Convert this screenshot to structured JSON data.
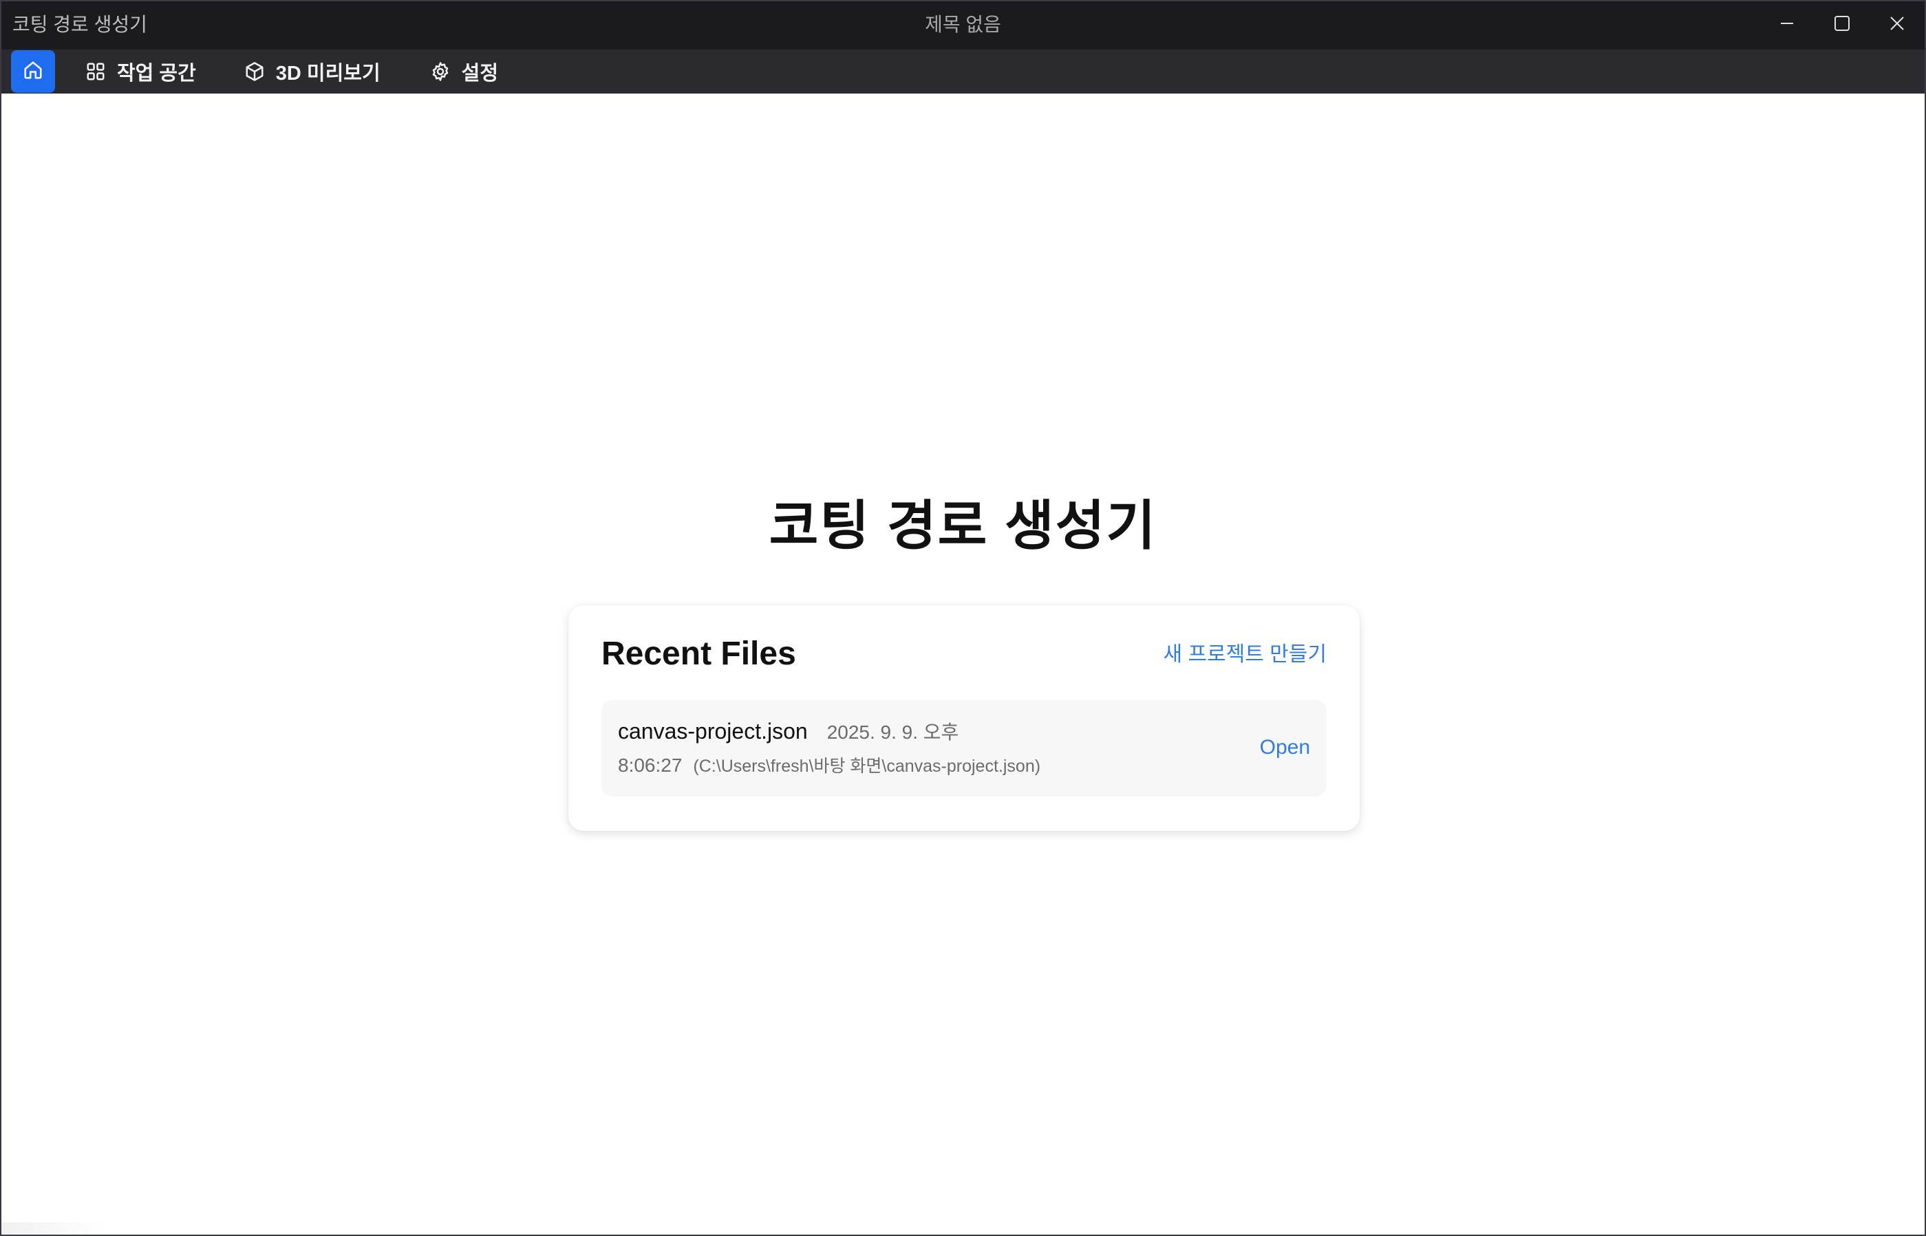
{
  "window": {
    "app_title": "코팅 경로 생성기",
    "document_title": "제목 없음",
    "controls": {
      "minimize_icon": "minimize-icon",
      "maximize_icon": "maximize-icon",
      "close_icon": "close-icon"
    }
  },
  "toolbar": {
    "home_icon": "home-icon",
    "accent_color": "#1f6cf0",
    "items": [
      {
        "label": "작업 공간",
        "icon": "grid-icon"
      },
      {
        "label": "3D 미리보기",
        "icon": "cube-icon"
      },
      {
        "label": "설정",
        "icon": "gear-icon"
      }
    ]
  },
  "main": {
    "title": "코팅 경로 생성기",
    "recent": {
      "heading": "Recent Files",
      "new_project_label": "새 프로젝트 만들기",
      "link_color": "#2f7de1",
      "files": [
        {
          "name": "canvas-project.json",
          "date_part1": "2025. 9. 9. 오후",
          "date_part2": "8:06:27",
          "path": "(C:\\Users\\fresh\\바탕 화면\\canvas-project.json)",
          "open_label": "Open"
        }
      ]
    }
  }
}
